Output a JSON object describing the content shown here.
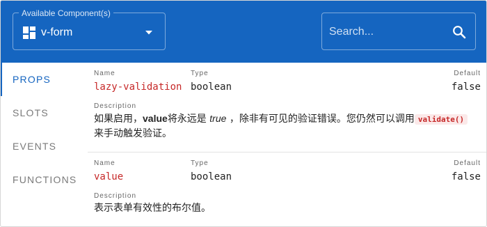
{
  "header": {
    "select_legend": "Available Component(s)",
    "select_value": "v-form",
    "search_placeholder": "Search..."
  },
  "tabs": [
    {
      "label": "PROPS",
      "active": true
    },
    {
      "label": "SLOTS",
      "active": false
    },
    {
      "label": "EVENTS",
      "active": false
    },
    {
      "label": "FUNCTIONS",
      "active": false
    }
  ],
  "columns": {
    "name": "Name",
    "type": "Type",
    "default": "Default",
    "description": "Description"
  },
  "props": [
    {
      "name": "lazy-validation",
      "type": "boolean",
      "default": "false",
      "desc_pre": "如果启用，",
      "desc_bold": "value",
      "desc_mid": "将永远是 ",
      "desc_italic": "true",
      "desc_post": " ，除非有可见的验证错误。您仍然可以调用",
      "desc_code": "validate()",
      "desc_end": "来手动触发验证。"
    },
    {
      "name": "value",
      "type": "boolean",
      "default": "false",
      "desc": "表示表单有效性的布尔值。"
    }
  ],
  "colors": {
    "primary": "#1565c0",
    "prop_name": "#c62828",
    "code_bg": "#fbe9e9"
  }
}
